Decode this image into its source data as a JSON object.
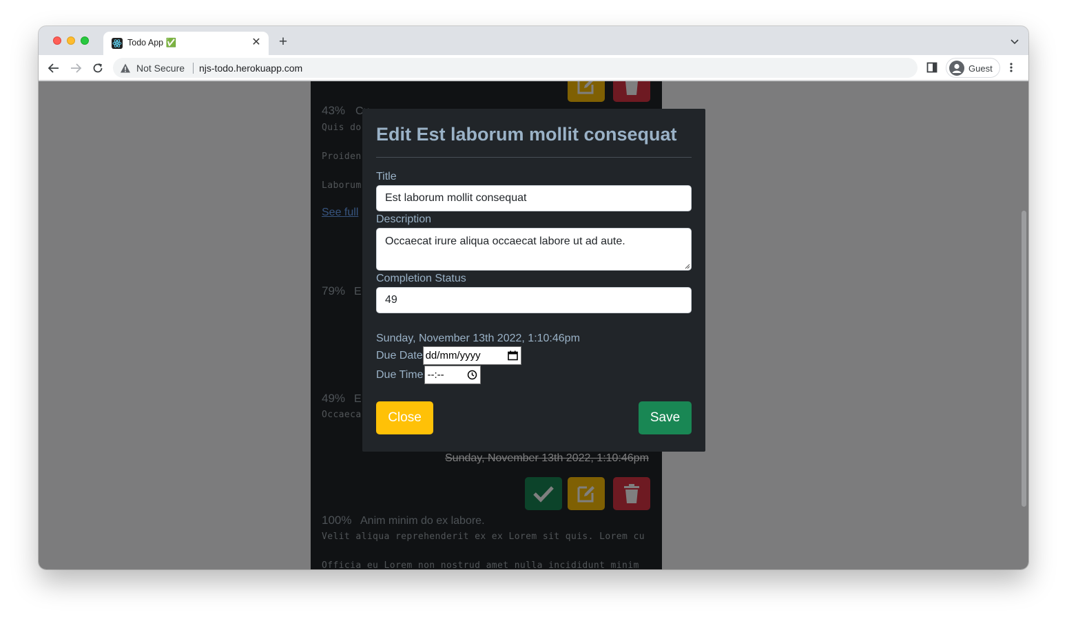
{
  "browser": {
    "tab_title": "Todo App ✅",
    "not_secure_label": "Not Secure",
    "url": "njs-todo.herokuapp.com",
    "profile_label": "Guest"
  },
  "background_todos": {
    "item1_pct": "43%",
    "item1_title": "Cu",
    "item1_desc_line1": "Quis do",
    "item1_desc_line2": "Proiden",
    "item1_desc_line3": "Laborum",
    "item1_link": "See full",
    "item2_pct": "79%",
    "item2_title": "E",
    "item3_pct": "49%",
    "item3_title": "E",
    "item3_desc": "Occaeca",
    "item3_date": "Sunday, November 13th 2022, 1:10:46pm",
    "item4_pct": "100%",
    "item4_title": "Anim minim do ex labore.",
    "item4_desc_line1": "Velit aliqua reprehenderit ex ex Lorem sit quis. Lorem cu",
    "item4_desc_line2": "Officia eu Lorem non nostrud amet nulla incididunt minim"
  },
  "modal": {
    "title": "Edit Est laborum mollit consequat",
    "title_label": "Title",
    "title_value": "Est laborum mollit consequat",
    "description_label": "Description",
    "description_value": "Occaecat irure aliqua occaecat labore ut ad aute.",
    "completion_label": "Completion Status",
    "completion_value": "49",
    "created_date": "Sunday, November 13th 2022, 1:10:46pm",
    "due_date_label": "Due Date",
    "due_date_placeholder": "dd/mm/yyyy",
    "due_time_label": "Due Time",
    "due_time_placeholder": "--:--",
    "close_label": "Close",
    "save_label": "Save"
  },
  "colors": {
    "modal_bg": "#212529",
    "accent_text": "#9ab2c7",
    "warning": "#ffc107",
    "success": "#198754",
    "danger": "#dc3545"
  }
}
